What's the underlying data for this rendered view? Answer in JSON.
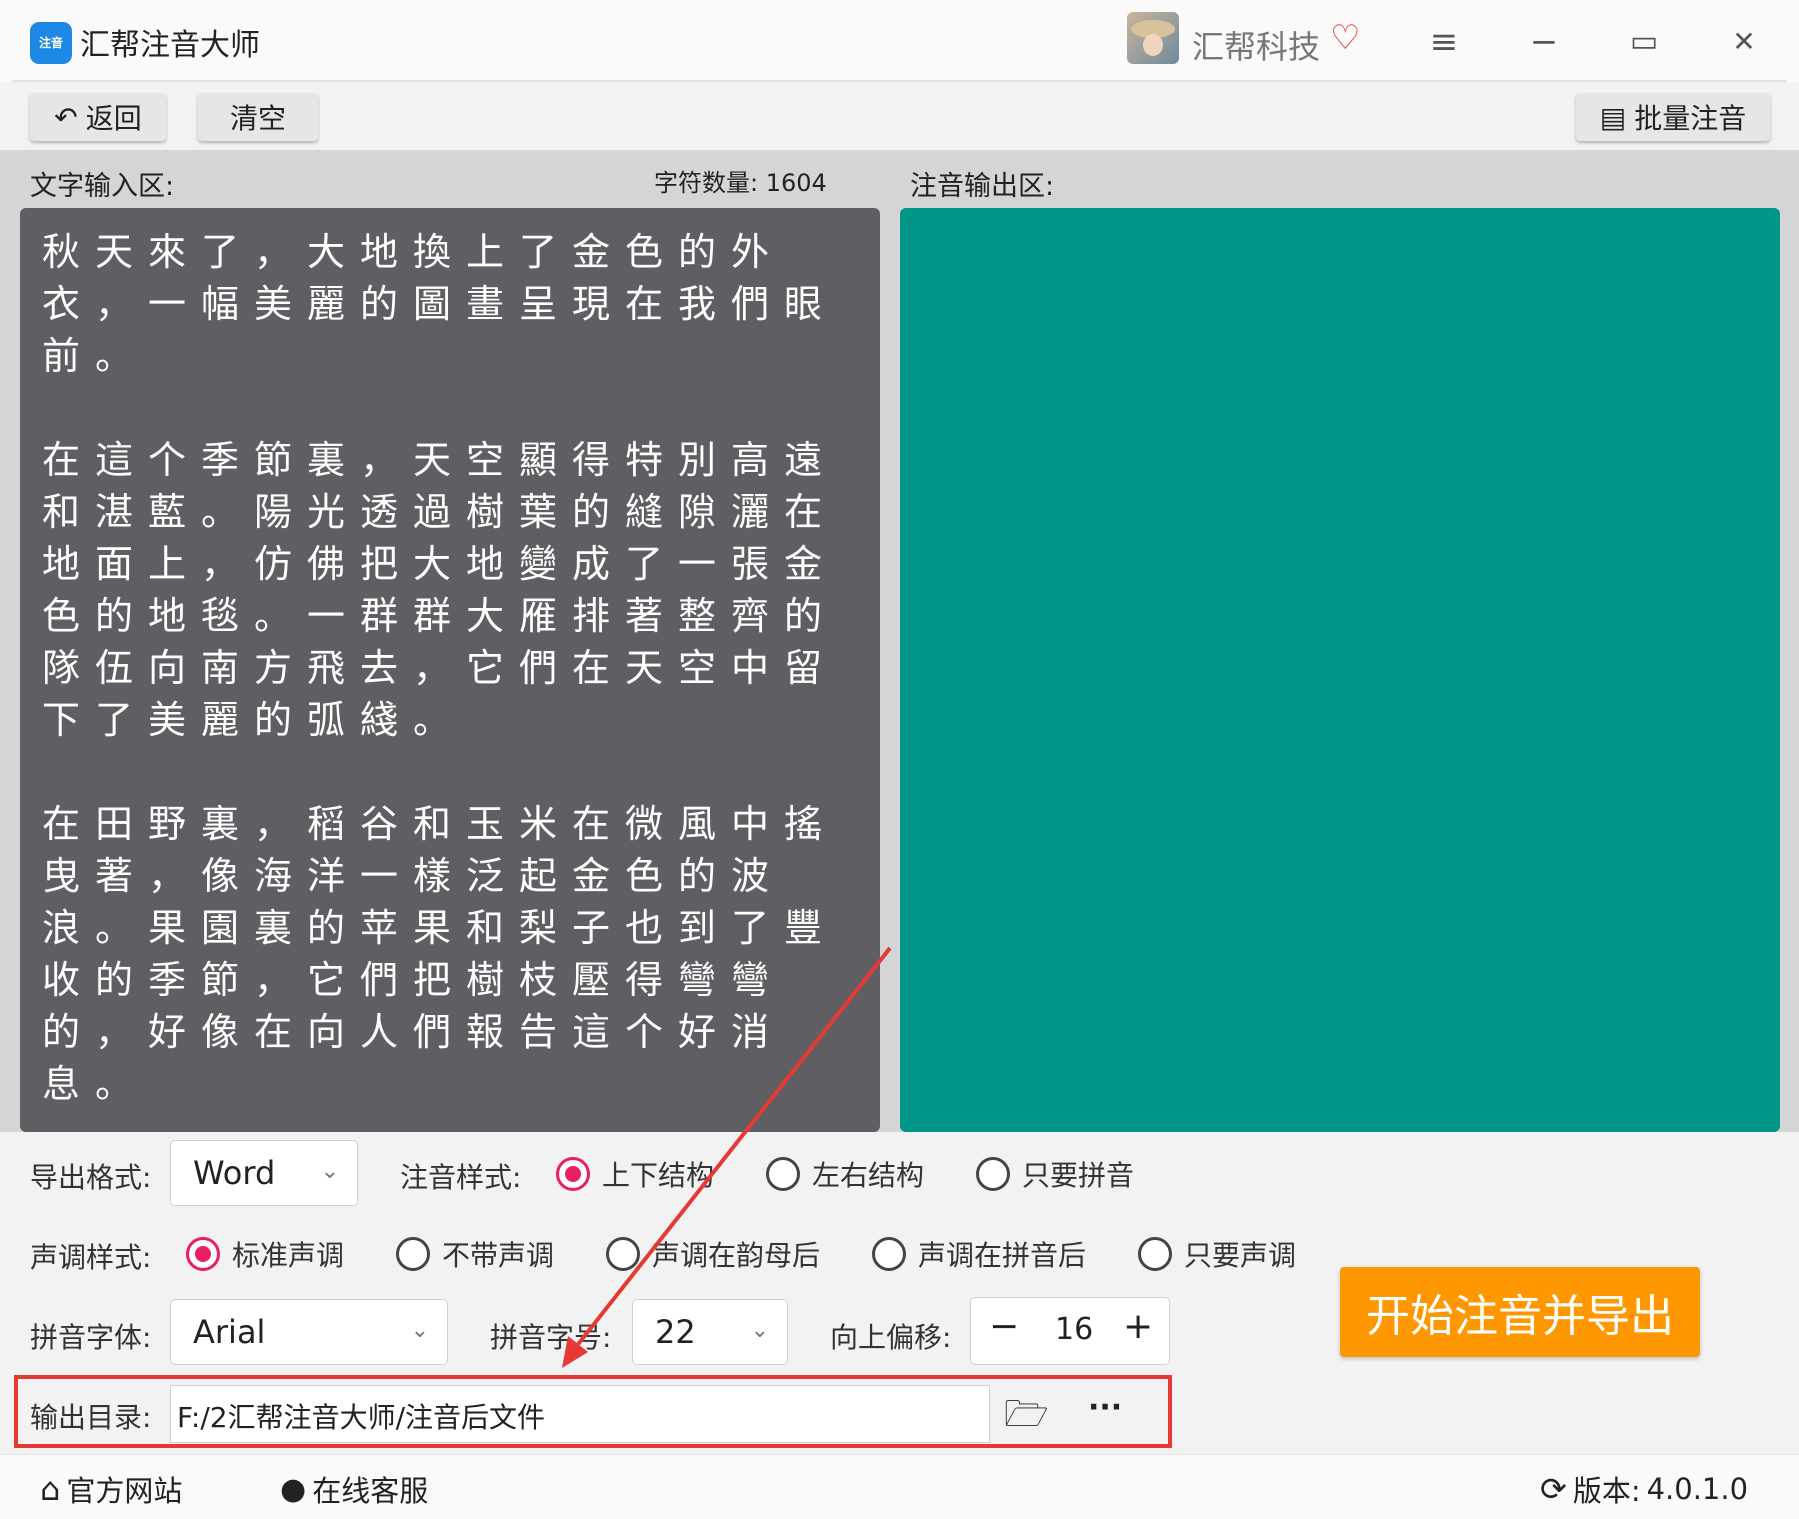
{
  "app": {
    "icon_text": "zhu yin 注音",
    "title": "汇帮注音大师"
  },
  "user": {
    "name": "汇帮科技"
  },
  "toolbar": {
    "back_label": "返回",
    "clear_label": "清空",
    "batch_label": "批量注音"
  },
  "input_area": {
    "label": "文字输入区:",
    "char_count_label": "字符数量:",
    "char_count": "1604",
    "text": "秋天來了，大地換上了金色的外衣，一幅美麗的圖畫呈現在我們眼前。\n\n在這个季節裏，天空顯得特別高遠和湛藍。陽光透過樹葉的縫隙灑在地面上，仿佛把大地變成了一張金色的地毯。一群群大雁排著整齊的隊伍向南方飛去，它們在天空中留下了美麗的弧綫。\n\n在田野裏，稻谷和玉米在微風中搖曳著，像海洋一樣泛起金色的波浪。果園裏的苹果和梨子也到了豐收的季節，它們把樹枝壓得彎彎的，好像在向人們報告這个好消息。"
  },
  "output_area": {
    "label": "注音输出区:"
  },
  "settings": {
    "export_format": {
      "label": "导出格式:",
      "value": "Word"
    },
    "pinyin_style": {
      "label": "注音样式:",
      "options": [
        "上下结构",
        "左右结构",
        "只要拼音"
      ],
      "selected": 0
    },
    "tone_style": {
      "label": "声调样式:",
      "options": [
        "标准声调",
        "不带声调",
        "声调在韵母后",
        "声调在拼音后",
        "只要声调"
      ],
      "selected": 0
    },
    "pinyin_font": {
      "label": "拼音字体:",
      "value": "Arial"
    },
    "pinyin_size": {
      "label": "拼音字号:",
      "value": "22"
    },
    "offset": {
      "label": "向上偏移:",
      "value": "16",
      "minus": "−",
      "plus": "+"
    },
    "output_dir": {
      "label": "输出目录:",
      "value": "F:/2汇帮注音大师/注音后文件",
      "more": "···"
    }
  },
  "start_button": "开始注音并导出",
  "footer": {
    "website": "官方网站",
    "service": "在线客服",
    "version_label": "版本:",
    "version": "4.0.1.0"
  },
  "colors": {
    "accent": "#ff9800",
    "output_bg": "#009688",
    "input_bg": "#5f5f63",
    "radio_on": "#e91e63",
    "highlight": "#e53935"
  }
}
